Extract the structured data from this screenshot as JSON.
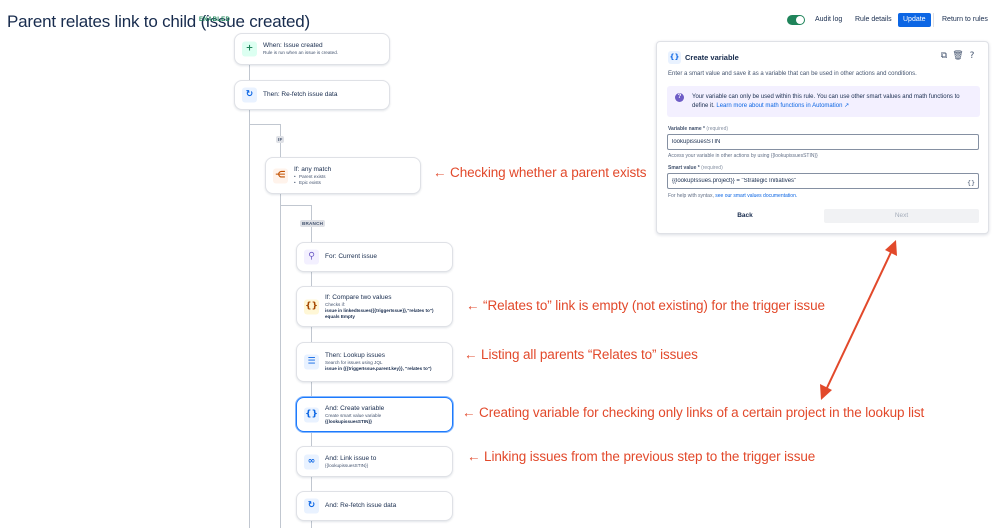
{
  "header": {
    "title": "Parent relates link to child (issue created)",
    "status_badge": "ENABLED",
    "audit_log": "Audit log",
    "rule_details": "Rule details",
    "update": "Update",
    "return": "Return to rules",
    "toggle_on": true
  },
  "flow": {
    "trigger": {
      "title": "When: Issue created",
      "sub": "Rule is run when an issue is created."
    },
    "refetch1": {
      "title": "Then: Re-fetch issue data"
    },
    "if_tag": "IF",
    "any_match": {
      "title": "If: any match",
      "items": [
        "Parent exists",
        "Epic exists"
      ]
    },
    "branch_tag": "BRANCH",
    "for_current": {
      "title": "For: Current issue"
    },
    "compare": {
      "title": "If: Compare two values",
      "sub": "Checks if:",
      "detail": "issue in linkedIssues({{triggerIssue}},\"relates to\") equals Empty"
    },
    "lookup": {
      "title": "Then: Lookup issues",
      "sub": "Search for issues using JQL",
      "detail": "issue in ({{triggerIssue.parent.key}}, \"relates to\")"
    },
    "create_var": {
      "title": "And: Create variable",
      "sub": "Create smart value variable",
      "detail": "{{lookupissuesSTIN}}"
    },
    "link_issue": {
      "title": "And: Link issue to",
      "sub": "{{lookupissuesSTIN}}"
    },
    "refetch2": {
      "title": "And: Re-fetch issue data"
    }
  },
  "annotations": {
    "a1": "← Checking whether a parent exists",
    "a2": "← “Relates to” link is empty (not existing) for the trigger issue",
    "a3": "← Listing all parents “Relates to” issues",
    "a4": "← Creating variable for checking only links of a certain project in the lookup list",
    "a5": "← Linking issues from the previous step to the trigger issue"
  },
  "panel": {
    "title": "Create variable",
    "description": "Enter a smart value and save it as a variable that can be used in other actions and conditions.",
    "info_text": "Your variable can only be used within this rule. You can use other smart values and math functions to define it.",
    "info_link": "Learn more about math functions in Automation ↗",
    "var_name_label": "Variable name *",
    "required": "(required)",
    "var_name_value": "lookupissuesSTIN",
    "var_name_help": "Access your variable in other actions by using {{lookupissuesSTIN}}",
    "smart_value_label": "Smart value *",
    "smart_value_value": "{{lookupIssues.project}} = \"Strategic Initiatives\"",
    "smart_value_help": "For help with syntax,",
    "smart_value_link": "see our smart values documentation.",
    "back": "Back",
    "next": "Next"
  },
  "colors": {
    "annotation": "#e2492b",
    "primary": "#0c66e4",
    "enabled": "#1f845a"
  }
}
